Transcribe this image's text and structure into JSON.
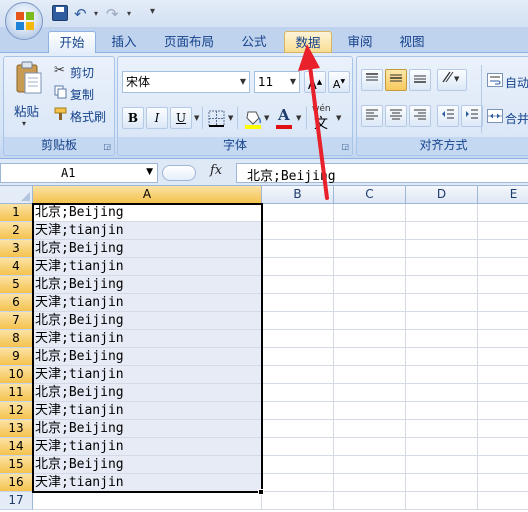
{
  "qat": {
    "undo_glyph": "↶",
    "redo_glyph": "↷",
    "more_glyph": "▾"
  },
  "tabs": [
    {
      "label": "开始",
      "active": true
    },
    {
      "label": "插入"
    },
    {
      "label": "页面布局"
    },
    {
      "label": "公式"
    },
    {
      "label": "数据",
      "highlighted": true
    },
    {
      "label": "审阅"
    },
    {
      "label": "视图"
    }
  ],
  "clipboard": {
    "paste": "粘贴",
    "cut": "剪切",
    "copy": "复制",
    "format_painter": "格式刷",
    "label": "剪贴板"
  },
  "font": {
    "name": "宋体",
    "size": "11",
    "grow": "A",
    "shrink": "A",
    "bold": "B",
    "italic": "I",
    "underline": "U",
    "font_color_letter": "A",
    "wen": "wén",
    "label": "字体"
  },
  "alignment": {
    "wrap": "自动",
    "merge": "合并",
    "label": "对齐方式"
  },
  "name_box": "A1",
  "fx": "fx",
  "formula": "北京;Beijing",
  "columns": [
    "A",
    "B",
    "C",
    "D",
    "E"
  ],
  "rows": [
    {
      "num": "1",
      "a": "北京;Beijing"
    },
    {
      "num": "2",
      "a": "天津;tianjin"
    },
    {
      "num": "3",
      "a": "北京;Beijing"
    },
    {
      "num": "4",
      "a": "天津;tianjin"
    },
    {
      "num": "5",
      "a": "北京;Beijing"
    },
    {
      "num": "6",
      "a": "天津;tianjin"
    },
    {
      "num": "7",
      "a": "北京;Beijing"
    },
    {
      "num": "8",
      "a": "天津;tianjin"
    },
    {
      "num": "9",
      "a": "北京;Beijing"
    },
    {
      "num": "10",
      "a": "天津;tianjin"
    },
    {
      "num": "11",
      "a": "北京;Beijing"
    },
    {
      "num": "12",
      "a": "天津;tianjin"
    },
    {
      "num": "13",
      "a": "北京;Beijing"
    },
    {
      "num": "14",
      "a": "天津;tianjin"
    },
    {
      "num": "15",
      "a": "北京;Beijing"
    },
    {
      "num": "16",
      "a": "天津;tianjin"
    },
    {
      "num": "17",
      "a": ""
    }
  ],
  "colors": {
    "selection_border": "#000000",
    "arrow": "#e8212b",
    "font_color_bar": "#e01010",
    "highlight_bar": "#ffff00"
  }
}
